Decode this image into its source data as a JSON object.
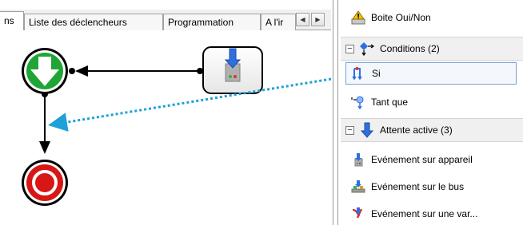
{
  "tabs": [
    {
      "label": "ns",
      "active": true
    },
    {
      "label": "Liste des déclencheurs",
      "active": false
    },
    {
      "label": "Programmation",
      "active": false
    },
    {
      "label": "A l'ir",
      "active": false
    }
  ],
  "tab_scroll": {
    "left_icon": "chevron-left-icon",
    "right_icon": "chevron-right-icon"
  },
  "diagram": {
    "start_node": {
      "icon": "down-arrow-icon",
      "color": "#1fa535"
    },
    "end_node": {
      "icon": "stop-icon",
      "color": "#d91616"
    },
    "event_block": {
      "icon": "device-event-icon"
    }
  },
  "toolbox": {
    "top_item": {
      "label": "Boite Oui/Non",
      "icon": "message-box-icon"
    },
    "groups": [
      {
        "label": "Conditions (2)",
        "expand_symbol": "−",
        "icon": "conditions-icon",
        "items": [
          {
            "label": "Si",
            "icon": "if-icon",
            "selected": true
          },
          {
            "label": "Tant que",
            "icon": "while-icon",
            "selected": false
          }
        ]
      },
      {
        "label": "Attente active (3)",
        "expand_symbol": "−",
        "icon": "active-wait-icon",
        "items": [
          {
            "label": "Evénement sur appareil",
            "icon": "device-event-icon"
          },
          {
            "label": "Evénement sur le bus",
            "icon": "bus-event-icon"
          },
          {
            "label": "Evénement sur une var...",
            "icon": "variable-event-icon"
          }
        ]
      }
    ]
  },
  "colors": {
    "drag_line": "#1ea0d8",
    "selection_border": "#7da2ce",
    "connector": "#000000"
  }
}
